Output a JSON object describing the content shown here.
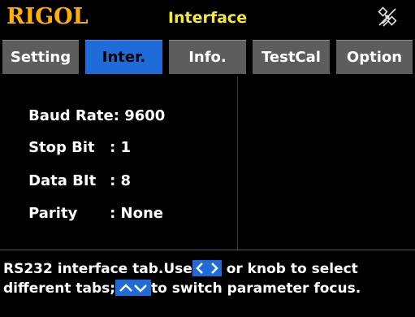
{
  "titlebar": {
    "logo": "RIGOL",
    "title": "Interface",
    "status_icon": "satellite-off-icon"
  },
  "tabs": [
    {
      "label": "Setting",
      "active": false
    },
    {
      "label": "Inter.",
      "active": true
    },
    {
      "label": "Info.",
      "active": false
    },
    {
      "label": "TestCal",
      "active": false
    },
    {
      "label": "Option",
      "active": false
    }
  ],
  "params": {
    "baud_rate": {
      "label": "Baud Rate",
      "value": ": 9600"
    },
    "stop_bit": {
      "label": "Stop Bit",
      "value": ": 1"
    },
    "data_bit": {
      "label": "Data BIt",
      "value": ": 8"
    },
    "parity": {
      "label": "Parity",
      "value": ": None"
    }
  },
  "help": {
    "line1_a": "RS232 interface tab.Use",
    "line1_b": "or knob to select",
    "line2_a": "different tabs;",
    "line2_b": "to switch parameter focus."
  },
  "colors": {
    "logo": "#ffb000",
    "title": "#f4ea3a",
    "tab_bg": "#5d5d5d",
    "tab_active_bg": "#1f6cd8",
    "background": "#000000"
  }
}
